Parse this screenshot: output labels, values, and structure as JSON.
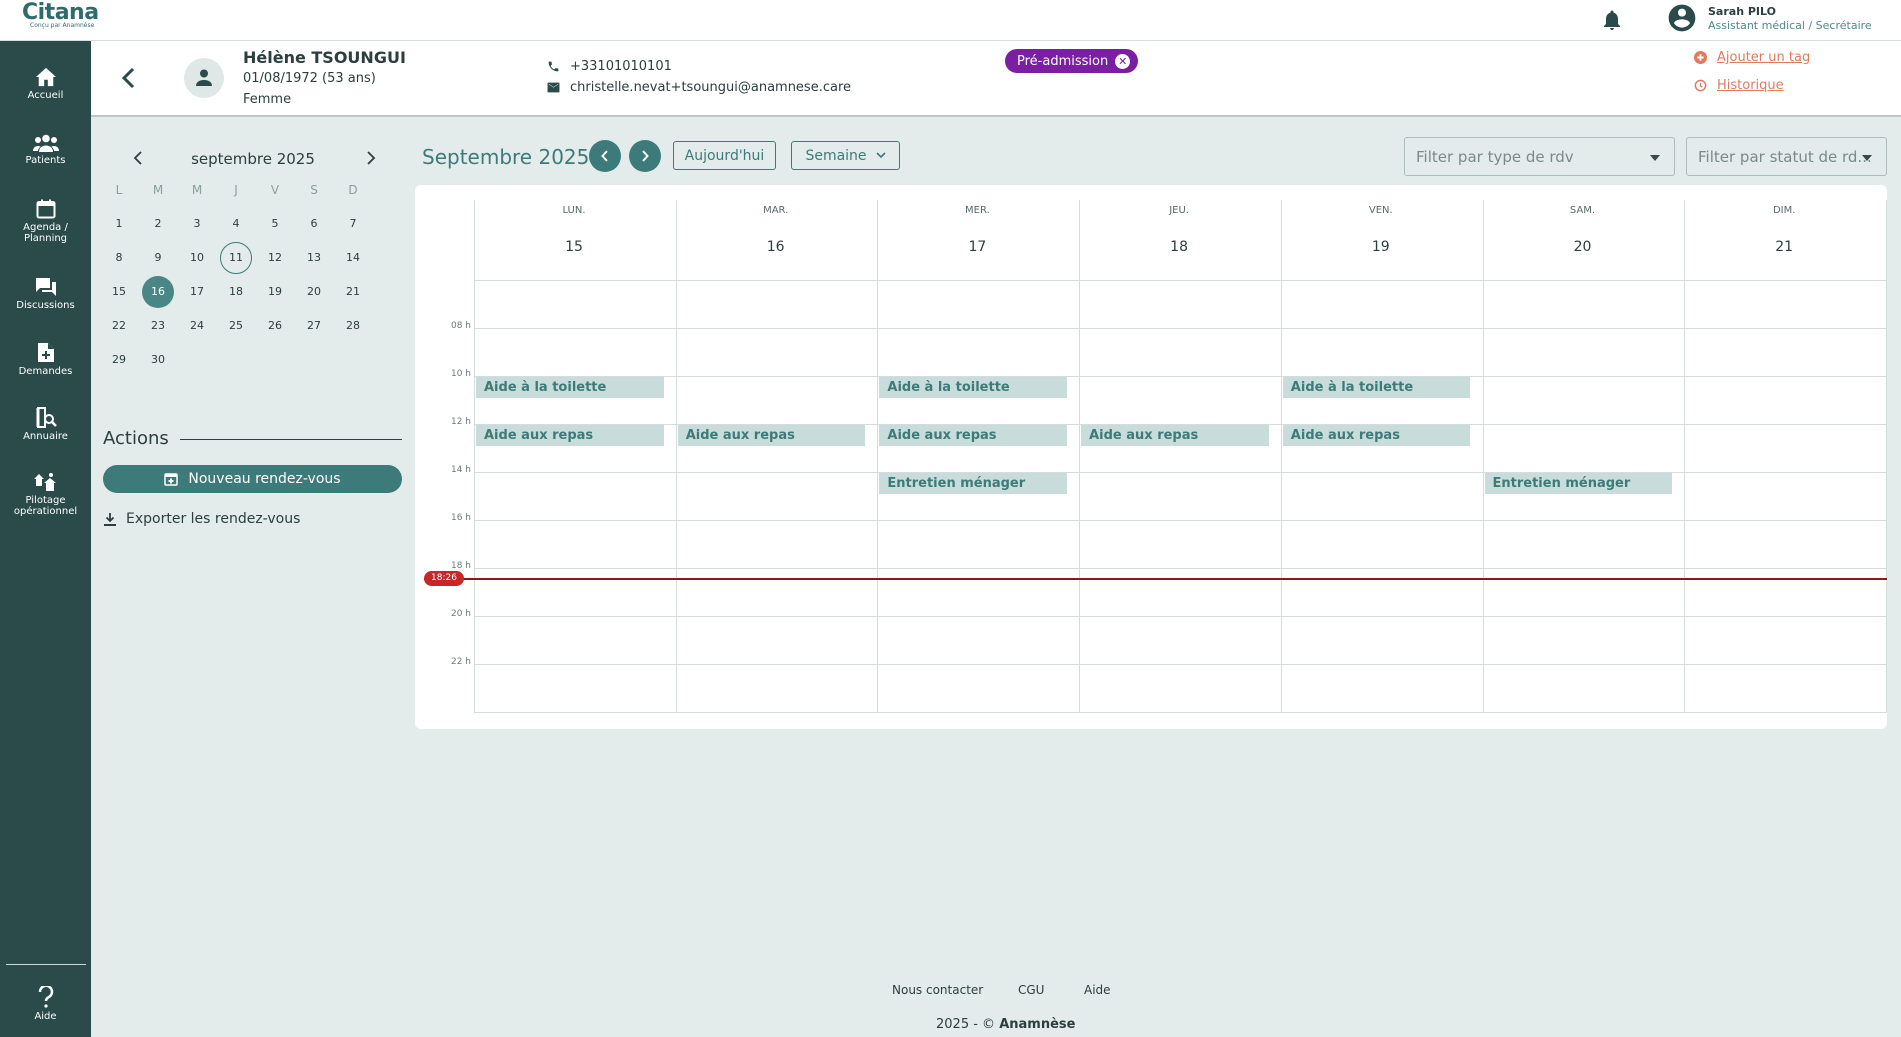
{
  "app": {
    "brand": "Citana",
    "tagline": "Conçu par Anamnèse"
  },
  "user": {
    "name": "Sarah PILO",
    "role": "Assistant médical / Secrétaire"
  },
  "sidebar": {
    "items": [
      {
        "label": "Accueil",
        "icon": "home-icon"
      },
      {
        "label": "Patients",
        "icon": "users-icon"
      },
      {
        "label1": "Agenda /",
        "label2": "Planning",
        "icon": "calendar-icon"
      },
      {
        "label": "Discussions",
        "icon": "chat-icon"
      },
      {
        "label": "Demandes",
        "icon": "document-icon"
      },
      {
        "label": "Annuaire",
        "icon": "directory-icon"
      },
      {
        "label1": "Pilotage",
        "label2": "opérationnel",
        "icon": "operations-icon"
      }
    ],
    "help": "Aide"
  },
  "patient": {
    "name": "Hélène TSOUNGUI",
    "dob": "01/08/1972 (53 ans)",
    "sex": "Femme",
    "phone": "+33101010101",
    "email": "christelle.nevat+tsoungui@anamnese.care",
    "status_badge": "Pré-admission",
    "add_tag": "Ajouter un tag",
    "history": "Historique"
  },
  "mini_calendar": {
    "title": "septembre 2025",
    "weekdays": [
      "L",
      "M",
      "M",
      "J",
      "V",
      "S",
      "D"
    ],
    "days": [
      "1",
      "2",
      "3",
      "4",
      "5",
      "6",
      "7",
      "8",
      "9",
      "10",
      "11",
      "12",
      "13",
      "14",
      "15",
      "16",
      "17",
      "18",
      "19",
      "20",
      "21",
      "22",
      "23",
      "24",
      "25",
      "26",
      "27",
      "28",
      "29",
      "30"
    ],
    "today": "11",
    "selected": "16"
  },
  "actions": {
    "title": "Actions",
    "new_appointment": "Nouveau rendez-vous",
    "export": "Exporter les rendez-vous"
  },
  "week_view": {
    "title": "Septembre 2025",
    "today_button": "Aujourd'hui",
    "view_select": "Semaine",
    "filter_type_placeholder": "Filter par type de rdv",
    "filter_status_placeholder": "Filter par statut de rd...",
    "days": [
      {
        "name": "LUN.",
        "num": "15"
      },
      {
        "name": "MAR.",
        "num": "16"
      },
      {
        "name": "MER.",
        "num": "17"
      },
      {
        "name": "JEU.",
        "num": "18"
      },
      {
        "name": "VEN.",
        "num": "19"
      },
      {
        "name": "SAM.",
        "num": "20"
      },
      {
        "name": "DIM.",
        "num": "21"
      }
    ],
    "hours": [
      "08 h",
      "10 h",
      "12 h",
      "14 h",
      "16 h",
      "18 h",
      "20 h",
      "22 h"
    ],
    "current_time": "18:26",
    "events": [
      {
        "day": 0,
        "slot": 2,
        "label": "Aide à la toilette"
      },
      {
        "day": 2,
        "slot": 2,
        "label": "Aide à la toilette"
      },
      {
        "day": 4,
        "slot": 2,
        "label": "Aide à la toilette"
      },
      {
        "day": 0,
        "slot": 3,
        "label": "Aide aux repas"
      },
      {
        "day": 1,
        "slot": 3,
        "label": "Aide aux repas"
      },
      {
        "day": 2,
        "slot": 3,
        "label": "Aide aux repas"
      },
      {
        "day": 3,
        "slot": 3,
        "label": "Aide aux repas"
      },
      {
        "day": 4,
        "slot": 3,
        "label": "Aide aux repas"
      },
      {
        "day": 2,
        "slot": 4,
        "label": "Entretien ménager"
      },
      {
        "day": 5,
        "slot": 4,
        "label": "Entretien ménager"
      }
    ]
  },
  "footer": {
    "contact": "Nous contacter",
    "cgu": "CGU",
    "help": "Aide",
    "copyright_prefix": "2025 - ©",
    "copyright_brand": "Anamnèse"
  }
}
